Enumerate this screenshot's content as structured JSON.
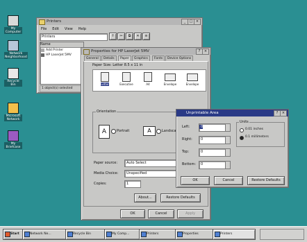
{
  "desktop": {
    "icons": [
      {
        "label": "My Computer"
      },
      {
        "label": "Network Neighborhood"
      },
      {
        "label": "Recycle Bin"
      },
      {
        "label": "Microsoft Network"
      },
      {
        "label": "My Briefcase"
      }
    ]
  },
  "explorer": {
    "title": "Printers",
    "menu": [
      "File",
      "Edit",
      "View",
      "Help"
    ],
    "address": "Printers",
    "list_header": "Name",
    "items": [
      "Add Printer",
      "HP LaserJet 5MV"
    ],
    "status": "1 object(s) selected"
  },
  "properties": {
    "title": "Properties for HP LaserJet 5MV",
    "tabs": [
      "General",
      "Details",
      "Paper",
      "Graphics",
      "Fonts",
      "Device Options"
    ],
    "paper_size_label": "Paper Size: Letter 8.5 x 11 in",
    "paper_icons": [
      "Letter",
      "Executive",
      "A4",
      "Envelope",
      "Envelope"
    ],
    "orientation_label": "Orientation",
    "portrait_label": "Portrait",
    "landscape_label": "Landscape",
    "paper_source_label": "Paper source:",
    "paper_source_value": "Auto Select",
    "media_choice_label": "Media Choice:",
    "media_choice_value": "Unspecified",
    "copies_label": "Copies:",
    "copies_value": "1",
    "about_button": "About...",
    "restore_button": "Restore Defaults",
    "ok_button": "OK",
    "cancel_button": "Cancel",
    "apply_button": "Apply"
  },
  "margins": {
    "title": "Unprintable Area",
    "fields": [
      {
        "label": "Left:",
        "value": "0"
      },
      {
        "label": "Right:",
        "value": "0"
      },
      {
        "label": "Top:",
        "value": "0"
      },
      {
        "label": "Bottom:",
        "value": "0"
      }
    ],
    "units_label": "Units",
    "unit_options": [
      "0.01 inches",
      "0.1 millimeters"
    ],
    "ok_button": "OK",
    "cancel_button": "Cancel",
    "restore_button": "Restore Defaults"
  },
  "taskbar": {
    "start": "Start",
    "buttons": [
      "Network Ne...",
      "Recycle Bin",
      "My Comp...",
      "Printers",
      "Properties",
      "Printers"
    ]
  },
  "colors": {
    "desktop": "#2a8f92",
    "active_title": "#2a3a86",
    "inactive_title": "#b6b6b6"
  }
}
